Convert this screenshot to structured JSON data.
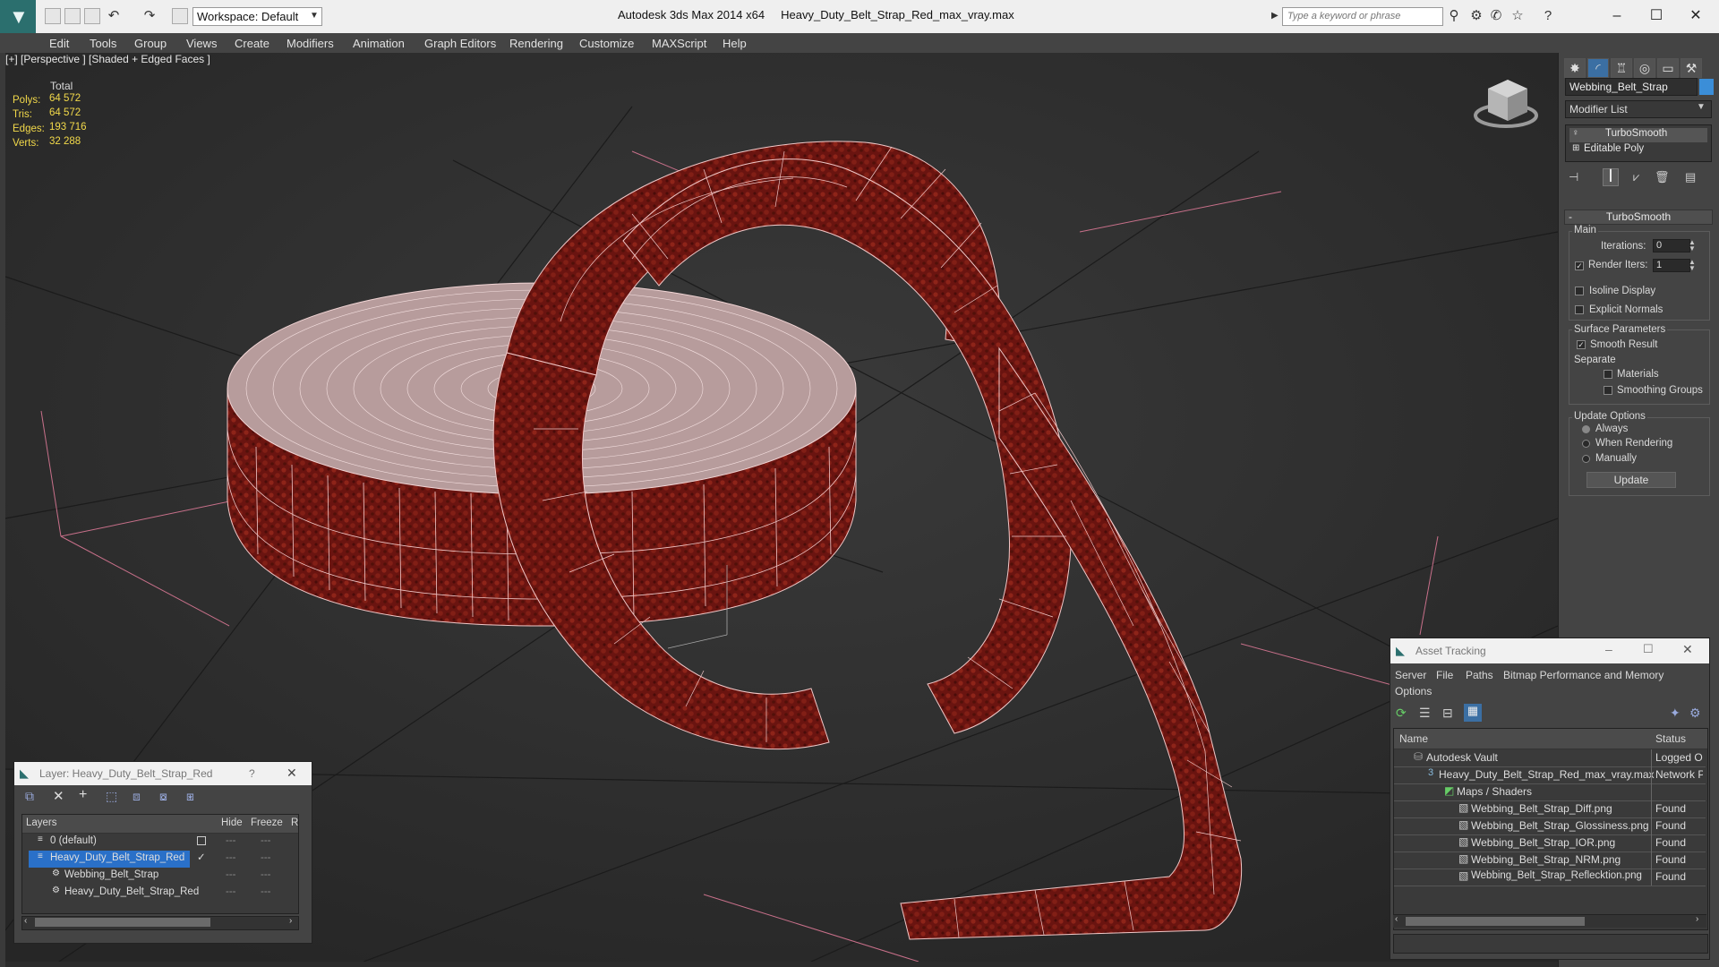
{
  "app": {
    "title": "Autodesk 3ds Max  2014 x64",
    "filename": "Heavy_Duty_Belt_Strap_Red_max_vray.max",
    "workspace": "Workspace: Default",
    "search_placeholder": "Type a keyword or phrase"
  },
  "menu": [
    "Edit",
    "Tools",
    "Group",
    "Views",
    "Create",
    "Modifiers",
    "Animation",
    "Graph Editors",
    "Rendering",
    "Customize",
    "MAXScript",
    "Help"
  ],
  "viewport": {
    "label": "[+] [Perspective ] [Shaded + Edged Faces ]",
    "stats_header": "Total",
    "stats": [
      {
        "label": "Polys:",
        "value": "64 572"
      },
      {
        "label": "Tris:",
        "value": "64 572"
      },
      {
        "label": "Edges:",
        "value": "193 716"
      },
      {
        "label": "Verts:",
        "value": "32 288"
      }
    ]
  },
  "command_panel": {
    "object_name": "Webbing_Belt_Strap",
    "object_color": "#3b8ed8",
    "modifier_list": "Modifier List",
    "stack": [
      "TurboSmooth",
      "Editable Poly"
    ],
    "rollout_title": "TurboSmooth",
    "main_label": "Main",
    "iterations_label": "Iterations:",
    "iterations_value": "0",
    "render_iters_label": "Render Iters:",
    "render_iters_value": "1",
    "isoline_display": "Isoline Display",
    "explicit_normals": "Explicit Normals",
    "surface_params": "Surface Parameters",
    "smooth_result": "Smooth Result",
    "separate": "Separate",
    "materials": "Materials",
    "smoothing_groups": "Smoothing Groups",
    "update_options": "Update Options",
    "always": "Always",
    "when_rendering": "When Rendering",
    "manually": "Manually",
    "update_button": "Update"
  },
  "layer_dialog": {
    "title": "Layer: Heavy_Duty_Belt_Strap_Red",
    "help": "?",
    "col_layers": "Layers",
    "col_hide": "Hide",
    "col_freeze": "Freeze",
    "col_r": "R",
    "rows": [
      "0 (default)",
      "Heavy_Duty_Belt_Strap_Red",
      "Webbing_Belt_Strap",
      "Heavy_Duty_Belt_Strap_Red"
    ]
  },
  "asset_tracking": {
    "title": "Asset Tracking",
    "menu": [
      "Server",
      "File",
      "Paths",
      "Bitmap Performance and Memory"
    ],
    "menu2": "Options",
    "col_name": "Name",
    "col_status": "Status",
    "rows": [
      {
        "name": "Autodesk Vault",
        "status": "Logged Ou"
      },
      {
        "name": "Heavy_Duty_Belt_Strap_Red_max_vray.max",
        "status": "Network Pa"
      },
      {
        "name": "Maps / Shaders",
        "status": ""
      },
      {
        "name": "Webbing_Belt_Strap_Diff.png",
        "status": "Found"
      },
      {
        "name": "Webbing_Belt_Strap_Glossiness.png",
        "status": "Found"
      },
      {
        "name": "Webbing_Belt_Strap_IOR.png",
        "status": "Found"
      },
      {
        "name": "Webbing_Belt_Strap_NRM.png",
        "status": "Found"
      },
      {
        "name": "Webbing_Belt_Strap_Reflecktion.png",
        "status": "Found"
      }
    ]
  }
}
